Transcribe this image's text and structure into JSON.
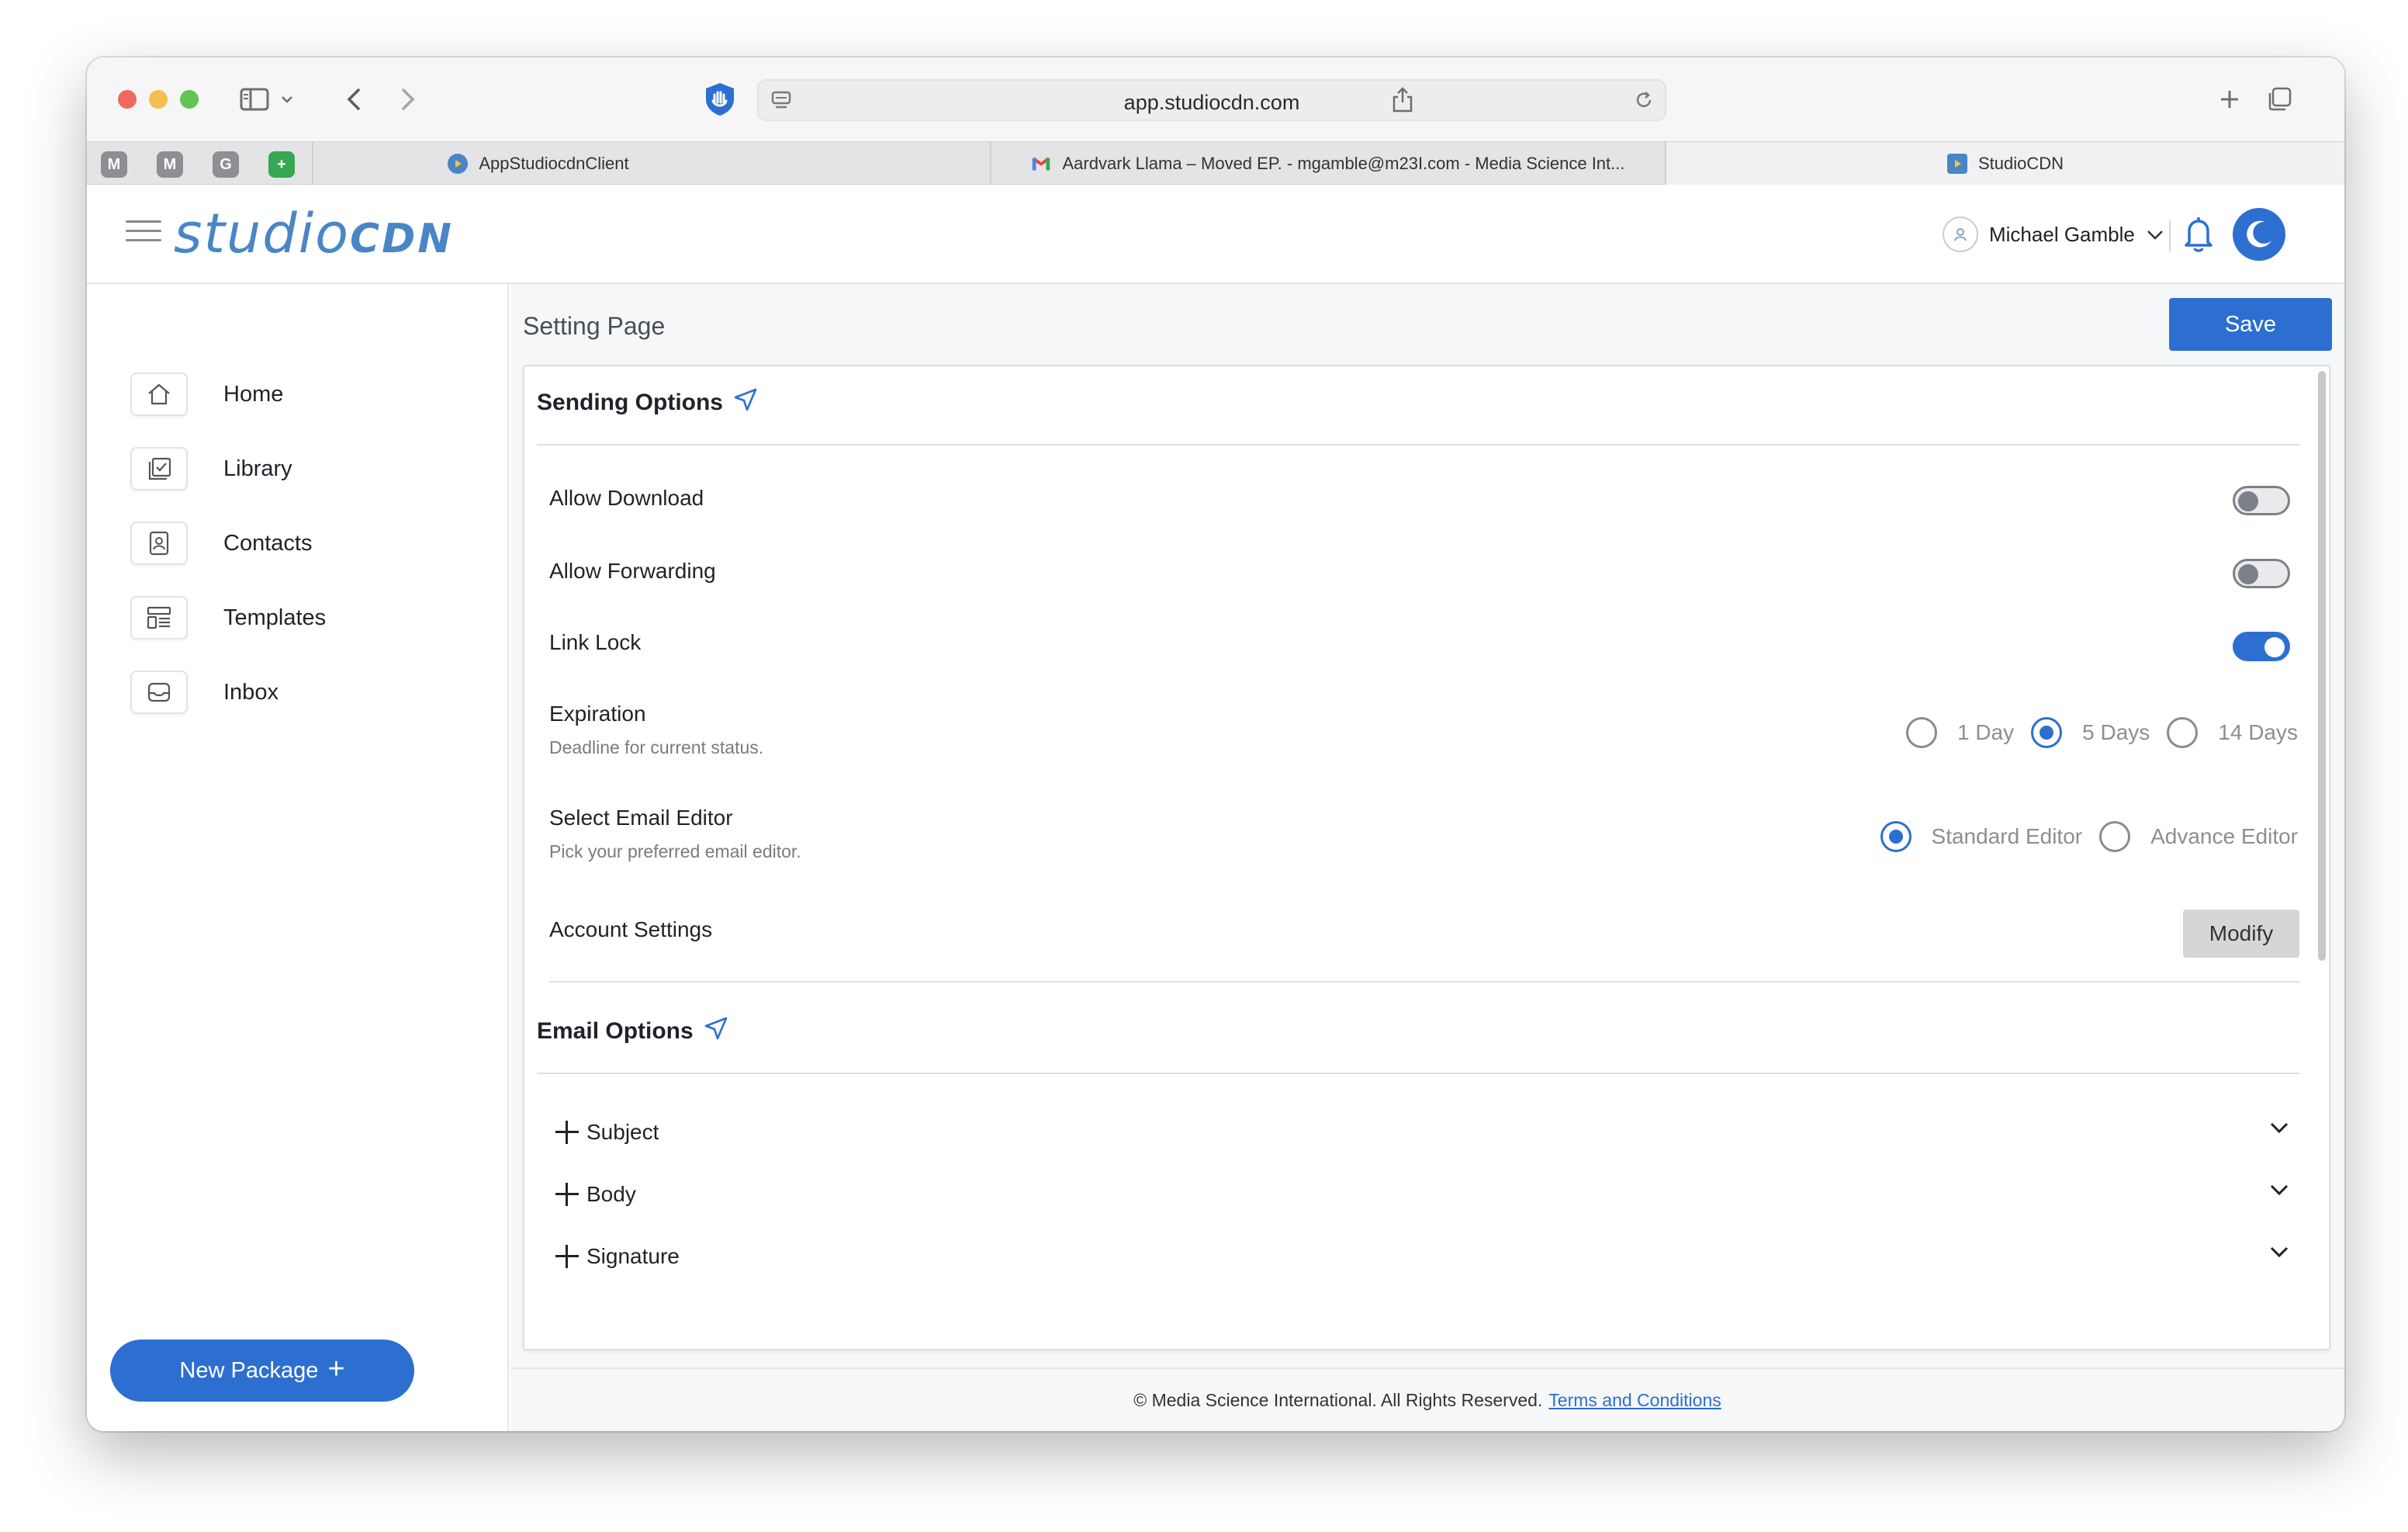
{
  "browser": {
    "url": "app.studiocdn.com",
    "pinned_tabs": [
      {
        "letter": "M",
        "color": "#8e8e93"
      },
      {
        "letter": "M",
        "color": "#8e8e93"
      },
      {
        "letter": "G",
        "color": "#8e8e93"
      },
      {
        "letter": "+",
        "color": "#34a853"
      }
    ],
    "tabs": [
      {
        "title": "AppStudiocdnClient",
        "active": false
      },
      {
        "title": "Aardvark Llama – Moved EP. - mgamble@m23I.com - Media Science Int...",
        "active": false
      },
      {
        "title": "StudioCDN",
        "active": true
      }
    ]
  },
  "header": {
    "logo_light": "studio",
    "logo_bold": "CDN",
    "user_name": "Michael Gamble",
    "accent": "#2c6fd1"
  },
  "sidebar": {
    "items": [
      {
        "label": "Home",
        "icon": "home-icon"
      },
      {
        "label": "Library",
        "icon": "library-icon"
      },
      {
        "label": "Contacts",
        "icon": "contacts-icon"
      },
      {
        "label": "Templates",
        "icon": "templates-icon"
      },
      {
        "label": "Inbox",
        "icon": "inbox-icon"
      }
    ],
    "new_package_label": "New Package"
  },
  "main": {
    "page_title": "Setting Page",
    "save_label": "Save",
    "sending_options": {
      "title": "Sending Options",
      "allow_download": {
        "label": "Allow Download",
        "enabled": false
      },
      "allow_forwarding": {
        "label": "Allow Forwarding",
        "enabled": false
      },
      "link_lock": {
        "label": "Link Lock",
        "enabled": true
      },
      "expiration": {
        "label": "Expiration",
        "description": "Deadline for current status.",
        "options": [
          "1 Day",
          "5 Days",
          "14 Days"
        ],
        "selected": "5 Days"
      },
      "email_editor": {
        "label": "Select Email Editor",
        "description": "Pick your preferred email editor.",
        "options": [
          "Standard Editor",
          "Advance Editor"
        ],
        "selected": "Standard Editor"
      },
      "account_settings": {
        "label": "Account Settings",
        "button": "Modify"
      }
    },
    "email_options": {
      "title": "Email Options",
      "items": [
        "Subject",
        "Body",
        "Signature"
      ]
    }
  },
  "footer": {
    "copyright": "© Media Science International. All Rights Reserved.",
    "terms_link": "Terms and Conditions"
  }
}
